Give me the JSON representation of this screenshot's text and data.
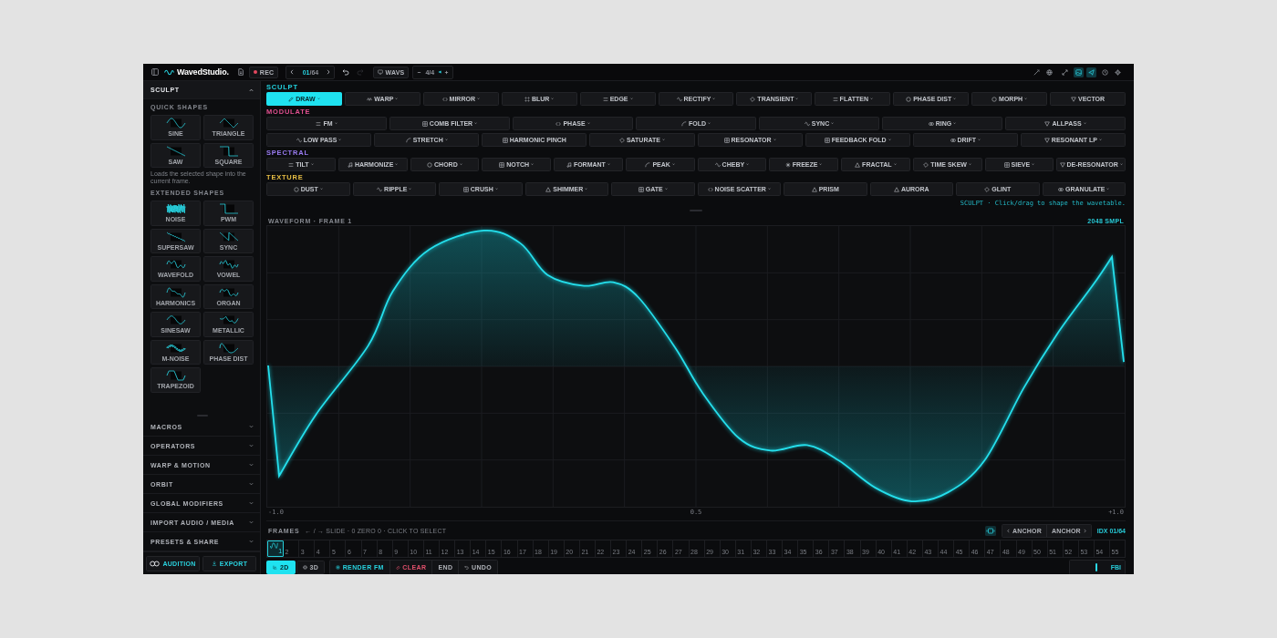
{
  "top_bar": {
    "brand": "WavedStudio.",
    "record_label": "REC",
    "frame_counter": {
      "current": "01",
      "total": "/64"
    },
    "history": [
      {
        "disabled": false
      },
      {
        "disabled": true
      }
    ],
    "format_label": "WAVS",
    "zoom_value": "4/4",
    "tools": [
      {
        "active": false
      },
      {
        "active": false
      },
      {
        "active": false
      },
      {
        "active": true
      },
      {
        "active": true
      },
      {
        "active": false
      },
      {
        "active": false
      }
    ]
  },
  "sidebar": {
    "panels": [
      {
        "title": "SCULPT",
        "expanded": true,
        "groups": [
          {
            "title": "QUICK SHAPES",
            "shapes": [
              {
                "label": "SINE",
                "kind": "sine"
              },
              {
                "label": "TRIANGLE",
                "kind": "triangle"
              },
              {
                "label": "SAW",
                "kind": "saw"
              },
              {
                "label": "SQUARE",
                "kind": "square"
              }
            ],
            "hint": "Loads the selected shape into the current frame."
          },
          {
            "title": "EXTENDED SHAPES",
            "shapes": [
              {
                "label": "NOISE",
                "kind": "noise"
              },
              {
                "label": "PWM",
                "kind": "pwm"
              },
              {
                "label": "SUPERSAW",
                "kind": "supersaw"
              },
              {
                "label": "SYNC",
                "kind": "sync"
              },
              {
                "label": "WAVEFOLD",
                "kind": "wavefold"
              },
              {
                "label": "VOWEL",
                "kind": "vowel"
              },
              {
                "label": "HARMONICS",
                "kind": "harmonics"
              },
              {
                "label": "ORGAN",
                "kind": "organ"
              },
              {
                "label": "SINESAW",
                "kind": "sinesaw"
              },
              {
                "label": "METALLIC",
                "kind": "metallic"
              },
              {
                "label": "M-NOISE",
                "kind": "mnoise"
              },
              {
                "label": "PHASE DIST",
                "kind": "phasedist"
              },
              {
                "label": "TRAPEZOID",
                "kind": "trapezoid"
              }
            ]
          }
        ]
      },
      {
        "title": "MACROS",
        "expanded": false
      },
      {
        "title": "OPERATORS",
        "expanded": false
      },
      {
        "title": "WARP & MOTION",
        "expanded": false
      },
      {
        "title": "ORBIT",
        "expanded": false
      },
      {
        "title": "GLOBAL MODIFIERS",
        "expanded": false
      },
      {
        "title": "IMPORT AUDIO / MEDIA",
        "expanded": false
      },
      {
        "title": "PRESETS & SHARE",
        "expanded": false
      }
    ],
    "footer": {
      "audition": "AUDITION",
      "export": "EXPORT"
    }
  },
  "toolbar": {
    "categories": [
      {
        "label": "SCULPT",
        "color": "#22d3e0",
        "rows": [
          {
            "buttons": [
              {
                "label": "DRAW",
                "selected": true,
                "has_menu": true
              },
              {
                "label": "WARP",
                "selected": false,
                "has_menu": true
              },
              {
                "label": "MIRROR",
                "selected": false,
                "has_menu": true
              },
              {
                "label": "BLUR",
                "selected": false,
                "has_menu": true
              },
              {
                "label": "EDGE",
                "selected": false,
                "has_menu": true
              },
              {
                "label": "RECTIFY",
                "selected": false,
                "has_menu": true
              },
              {
                "label": "TRANSIENT",
                "selected": false,
                "has_menu": true
              },
              {
                "label": "FLATTEN",
                "selected": false,
                "has_menu": true
              },
              {
                "label": "PHASE DIST",
                "selected": false,
                "has_menu": true
              },
              {
                "label": "MORPH",
                "selected": false,
                "has_menu": true
              },
              {
                "label": "VECTOR",
                "selected": false,
                "has_menu": false
              }
            ]
          }
        ]
      },
      {
        "label": "MODULATE",
        "color": "#e0508f",
        "rows": [
          {
            "buttons": [
              {
                "label": "FM",
                "selected": false,
                "has_menu": true
              },
              {
                "label": "COMB FILTER",
                "selected": false,
                "has_menu": true
              },
              {
                "label": "PHASE",
                "selected": false,
                "has_menu": true
              },
              {
                "label": "FOLD",
                "selected": false,
                "has_menu": true
              },
              {
                "label": "SYNC",
                "selected": false,
                "has_menu": true
              },
              {
                "label": "RING",
                "selected": false,
                "has_menu": true
              },
              {
                "label": "ALLPASS",
                "selected": false,
                "has_menu": true
              }
            ]
          },
          {
            "buttons": [
              {
                "label": "LOW PASS",
                "selected": false,
                "has_menu": true
              },
              {
                "label": "STRETCH",
                "selected": false,
                "has_menu": true
              },
              {
                "label": "HARMONIC PINCH",
                "selected": false,
                "has_menu": false
              },
              {
                "label": "SATURATE",
                "selected": false,
                "has_menu": true
              },
              {
                "label": "RESONATOR",
                "selected": false,
                "has_menu": true
              },
              {
                "label": "FEEDBACK FOLD",
                "selected": false,
                "has_menu": true
              },
              {
                "label": "DRIFT",
                "selected": false,
                "has_menu": true
              },
              {
                "label": "RESONANT LP",
                "selected": false,
                "has_menu": true
              }
            ]
          }
        ]
      },
      {
        "label": "SPECTRAL",
        "color": "#9a7cf2",
        "rows": [
          {
            "buttons": [
              {
                "label": "TILT",
                "selected": false,
                "has_menu": true
              },
              {
                "label": "HARMONIZE",
                "selected": false,
                "has_menu": true
              },
              {
                "label": "CHORD",
                "selected": false,
                "has_menu": true
              },
              {
                "label": "NOTCH",
                "selected": false,
                "has_menu": true
              },
              {
                "label": "FORMANT",
                "selected": false,
                "has_menu": true
              },
              {
                "label": "PEAK",
                "selected": false,
                "has_menu": true
              },
              {
                "label": "CHEBY",
                "selected": false,
                "has_menu": true
              },
              {
                "label": "FREEZE",
                "selected": false,
                "has_menu": true
              },
              {
                "label": "FRACTAL",
                "selected": false,
                "has_menu": true
              },
              {
                "label": "TIME SKEW",
                "selected": false,
                "has_menu": true
              },
              {
                "label": "SIEVE",
                "selected": false,
                "has_menu": true
              },
              {
                "label": "DE-RESONATOR",
                "selected": false,
                "has_menu": true
              }
            ]
          }
        ]
      },
      {
        "label": "TEXTURE",
        "color": "#e8bf45",
        "rows": [
          {
            "buttons": [
              {
                "label": "DUST",
                "selected": false,
                "has_menu": true
              },
              {
                "label": "RIPPLE",
                "selected": false,
                "has_menu": true
              },
              {
                "label": "CRUSH",
                "selected": false,
                "has_menu": true
              },
              {
                "label": "SHIMMER",
                "selected": false,
                "has_menu": true
              },
              {
                "label": "GATE",
                "selected": false,
                "has_menu": true
              },
              {
                "label": "NOISE SCATTER",
                "selected": false,
                "has_menu": true
              },
              {
                "label": "PRISM",
                "selected": false,
                "has_menu": false
              },
              {
                "label": "AURORA",
                "selected": false,
                "has_menu": false
              },
              {
                "label": "GLINT",
                "selected": false,
                "has_menu": false
              },
              {
                "label": "GRANULATE",
                "selected": false,
                "has_menu": true
              }
            ]
          }
        ]
      }
    ],
    "hint": "SCULPT · Click/drag to shape the wavetable."
  },
  "waveform": {
    "title": "WAVEFORM · FRAME 1",
    "samples": "2048 SMPL",
    "axis_labels": [
      "-1.0",
      "0.5",
      "+1.0"
    ]
  },
  "frames": {
    "title": "FRAMES",
    "hint": "← / → SLIDE · 0 ZERO 0 · CLICK TO SELECT",
    "anchor_prev": "ANCHOR",
    "anchor_next": "ANCHOR",
    "index": "IDX 01/64",
    "cells": [
      {
        "label": "1",
        "selected": true
      },
      {
        "label": "2",
        "selected": false
      },
      {
        "label": "3",
        "selected": false
      },
      {
        "label": "4",
        "selected": false
      },
      {
        "label": "5",
        "selected": false
      },
      {
        "label": "6",
        "selected": false
      },
      {
        "label": "7",
        "selected": false
      },
      {
        "label": "8",
        "selected": false
      },
      {
        "label": "9",
        "selected": false
      },
      {
        "label": "10",
        "selected": false
      },
      {
        "label": "11",
        "selected": false
      },
      {
        "label": "12",
        "selected": false
      },
      {
        "label": "13",
        "selected": false
      },
      {
        "label": "14",
        "selected": false
      },
      {
        "label": "15",
        "selected": false
      },
      {
        "label": "16",
        "selected": false
      },
      {
        "label": "17",
        "selected": false
      },
      {
        "label": "18",
        "selected": false
      },
      {
        "label": "19",
        "selected": false
      },
      {
        "label": "20",
        "selected": false
      },
      {
        "label": "21",
        "selected": false
      },
      {
        "label": "22",
        "selected": false
      },
      {
        "label": "23",
        "selected": false
      },
      {
        "label": "24",
        "selected": false
      },
      {
        "label": "25",
        "selected": false
      },
      {
        "label": "26",
        "selected": false
      },
      {
        "label": "27",
        "selected": false
      },
      {
        "label": "28",
        "selected": false
      },
      {
        "label": "29",
        "selected": false
      },
      {
        "label": "30",
        "selected": false
      },
      {
        "label": "31",
        "selected": false
      },
      {
        "label": "32",
        "selected": false
      },
      {
        "label": "33",
        "selected": false
      },
      {
        "label": "34",
        "selected": false
      },
      {
        "label": "35",
        "selected": false
      },
      {
        "label": "36",
        "selected": false
      },
      {
        "label": "37",
        "selected": false
      },
      {
        "label": "38",
        "selected": false
      },
      {
        "label": "39",
        "selected": false
      },
      {
        "label": "40",
        "selected": false
      },
      {
        "label": "41",
        "selected": false
      },
      {
        "label": "42",
        "selected": false
      },
      {
        "label": "43",
        "selected": false
      },
      {
        "label": "44",
        "selected": false
      },
      {
        "label": "45",
        "selected": false
      },
      {
        "label": "46",
        "selected": false
      },
      {
        "label": "47",
        "selected": false
      },
      {
        "label": "48",
        "selected": false
      },
      {
        "label": "49",
        "selected": false
      },
      {
        "label": "50",
        "selected": false
      },
      {
        "label": "51",
        "selected": false
      },
      {
        "label": "52",
        "selected": false
      },
      {
        "label": "53",
        "selected": false
      },
      {
        "label": "54",
        "selected": false
      },
      {
        "label": "55",
        "selected": false
      }
    ]
  },
  "bottom_bar": {
    "views": [
      {
        "label": "2D",
        "selected": true
      },
      {
        "label": "3D",
        "selected": false
      }
    ],
    "actions": [
      {
        "label": "RENDER FM",
        "kind": "accent"
      },
      {
        "label": "CLEAR",
        "kind": "danger"
      },
      {
        "label": "END",
        "kind": "plain"
      },
      {
        "label": "UNDO",
        "kind": "plain"
      }
    ],
    "slider": {
      "level": 0.75,
      "label": "FBI"
    }
  }
}
